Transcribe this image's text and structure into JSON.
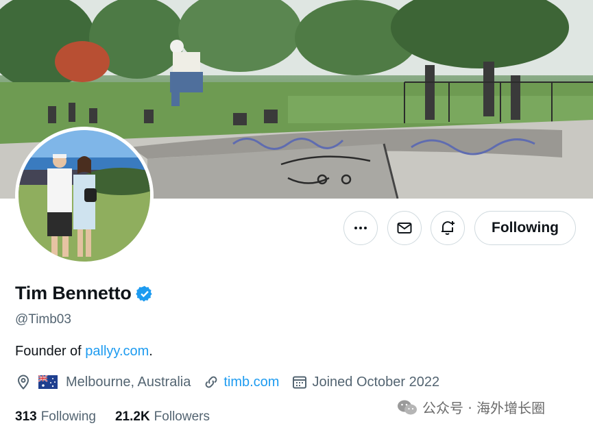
{
  "profile": {
    "name": "Tim Bennetto",
    "handle": "@Timb03",
    "bio_prefix": "Founder of ",
    "bio_link": "pallyy.com",
    "bio_suffix": ".",
    "location": "Melbourne, Australia",
    "website": "timb.com",
    "joined": "Joined October 2022",
    "following_count": "313",
    "following_label": "Following",
    "followers_count": "21.2K",
    "followers_label": "Followers"
  },
  "actions": {
    "following_button": "Following"
  },
  "icons": {
    "more": "more-horizontal-icon",
    "message": "envelope-icon",
    "notify": "bell-plus-icon",
    "verified": "verified-badge-icon",
    "location": "location-pin-icon",
    "flag": "australia-flag-icon",
    "link": "link-icon",
    "calendar": "calendar-icon"
  },
  "colors": {
    "accent": "#1d9bf0",
    "text": "#0f1419",
    "secondary": "#536471"
  },
  "watermark": {
    "text": "公众号 · 海外增长圈"
  }
}
